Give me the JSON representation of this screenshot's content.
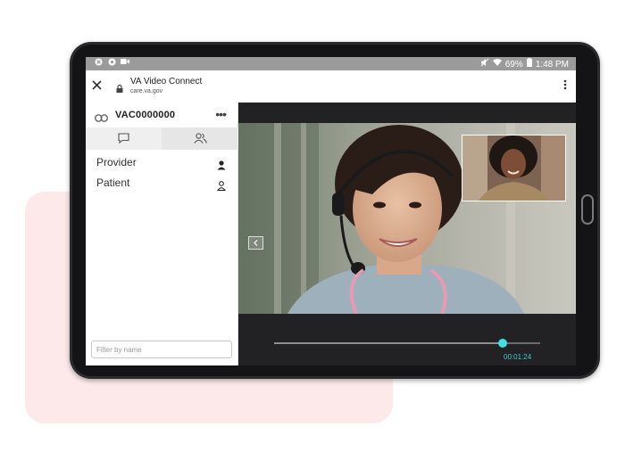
{
  "status_bar": {
    "battery": "69%",
    "time": "1:48 PM"
  },
  "browser": {
    "title": "VA Video Connect",
    "url": "care.va.gov"
  },
  "sidebar": {
    "session_id": "VAC0000000",
    "more_label": "•••",
    "participants": [
      {
        "name": "Provider"
      },
      {
        "name": "Patient"
      }
    ],
    "filter_placeholder": "Filter by name"
  },
  "video": {
    "progress_fraction": 0.86,
    "elapsed": "00:01:24"
  },
  "colors": {
    "accent": "#3fe0e3",
    "background_card": "#fde9ea"
  }
}
